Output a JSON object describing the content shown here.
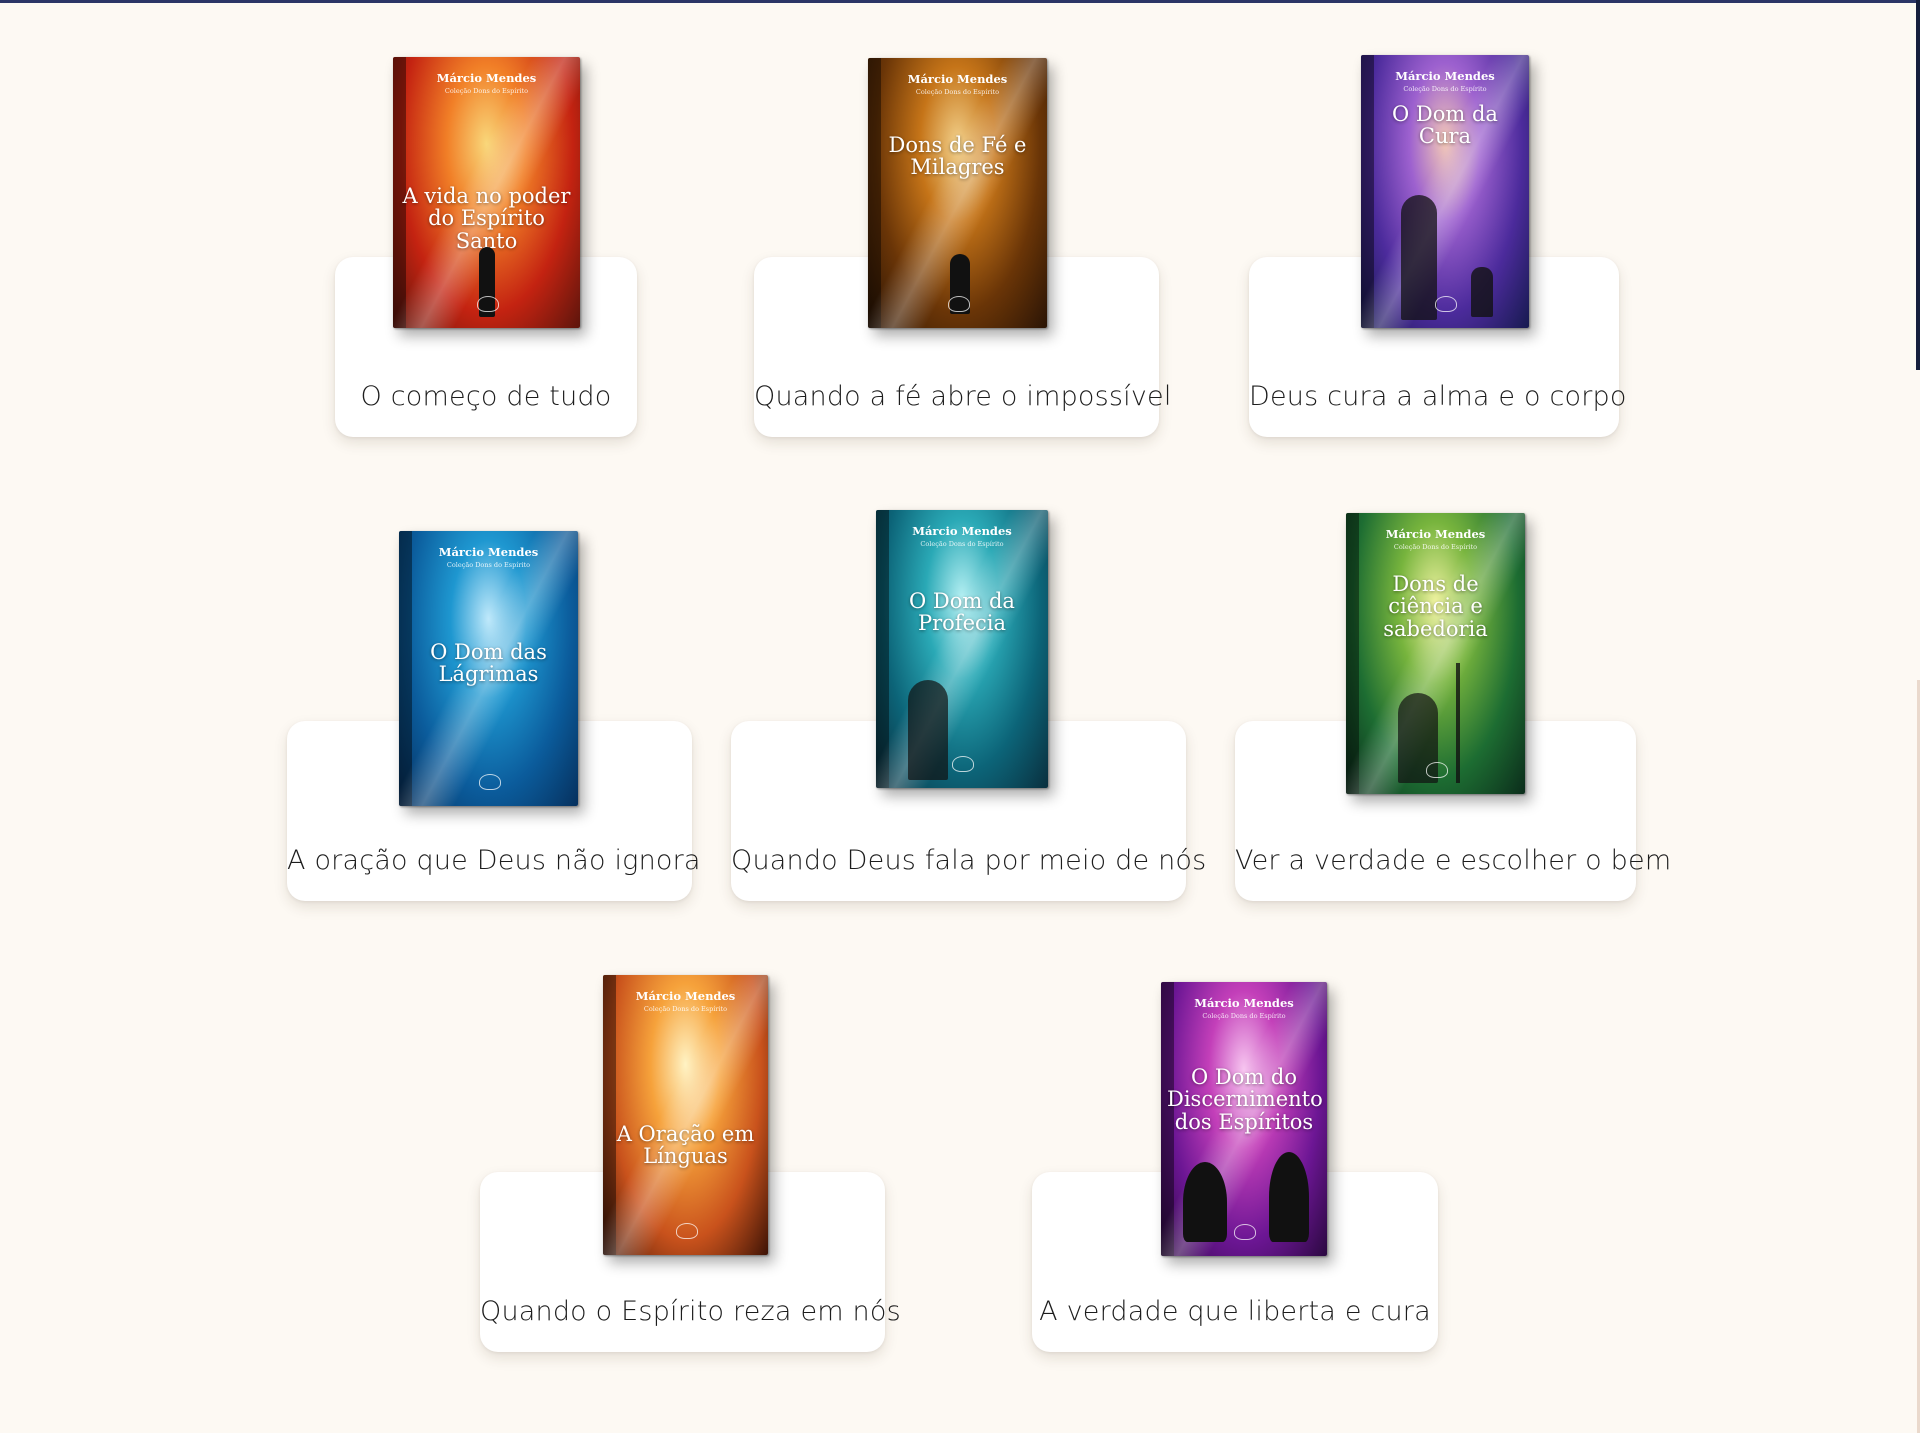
{
  "books": [
    {
      "author": "Márcio Mendes",
      "collection": "Coleção Dons do Espírito",
      "cover_title": "A vida no poder do Espírito Santo",
      "caption": "O começo de tudo",
      "colors": [
        "#f9d77a",
        "#f17f27",
        "#c42311",
        "#5c150c"
      ]
    },
    {
      "author": "Márcio Mendes",
      "collection": "Coleção Dons do Espírito",
      "cover_title": "Dons de Fé e Milagres",
      "caption": "Quando a fé abre o impossível",
      "colors": [
        "#f2d08a",
        "#c57418",
        "#6a3507",
        "#2a1405"
      ]
    },
    {
      "author": "Márcio Mendes",
      "collection": "Coleção Dons do Espírito",
      "cover_title": "O Dom da Cura",
      "caption": "Deus cura a alma e o corpo",
      "colors": [
        "#f2c7b7",
        "#9d61cf",
        "#4c2b9c",
        "#161a4f"
      ]
    },
    {
      "author": "Márcio Mendes",
      "collection": "Coleção Dons do Espírito",
      "cover_title": "O Dom das Lágrimas",
      "caption": "A oração que Deus não ignora",
      "colors": [
        "#bfe9fb",
        "#1e97d0",
        "#0b5c9c",
        "#06305d"
      ]
    },
    {
      "author": "Márcio Mendes",
      "collection": "Coleção Dons do Espírito",
      "cover_title": "O Dom da Profecia",
      "caption": "Quando Deus fala por meio de nós",
      "colors": [
        "#b6f0f3",
        "#2aa9b6",
        "#0c6478",
        "#0a2f3e"
      ]
    },
    {
      "author": "Márcio Mendes",
      "collection": "Coleção Dons do Espírito",
      "cover_title": "Dons de ciência e sabedoria",
      "caption": "Ver a verdade e escolher o bem",
      "colors": [
        "#eff2a0",
        "#77b43d",
        "#1d6d32",
        "#0b2c1b"
      ]
    },
    {
      "author": "Márcio Mendes",
      "collection": "Coleção Dons do Espírito",
      "cover_title": "A Oração em Línguas",
      "caption": "Quando o Espírito reza em nós",
      "colors": [
        "#fff3c4",
        "#f6a23b",
        "#c9521c",
        "#3d1306"
      ]
    },
    {
      "author": "Márcio Mendes",
      "collection": "Coleção Dons do Espírito",
      "cover_title": "O Dom do Discernimento dos Espíritos",
      "caption": "A verdade que liberta e cura",
      "colors": [
        "#f7c6f0",
        "#c33fb9",
        "#6c1694",
        "#2b0940"
      ]
    }
  ]
}
